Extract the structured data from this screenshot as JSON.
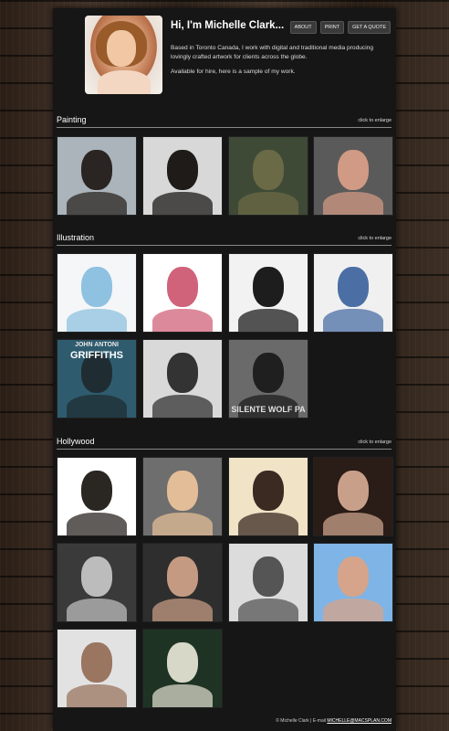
{
  "header": {
    "title": "Hi, I'm Michelle Clark...",
    "bio": [
      "Based in Toronto Canada, I work with digital and traditional media producing lovingly crafted artwork for clients across the globe.",
      "Available for hire, here is a sample of my work."
    ],
    "nav": [
      "ABOUT",
      "PRINT",
      "GET A QUOTE"
    ]
  },
  "sections": [
    {
      "title": "Painting",
      "note": "click to enlarge",
      "thumbs": [
        {
          "bg": "#aab4ba",
          "fg": "#2a2522"
        },
        {
          "bg": "#d8d8d8",
          "fg": "#1e1b19"
        },
        {
          "bg": "#3f4a36",
          "fg": "#6b6a46"
        },
        {
          "bg": "#5a5a5a",
          "fg": "#d09a84"
        }
      ]
    },
    {
      "title": "Illustration",
      "note": "click to enlarge",
      "thumbs": [
        {
          "bg": "#f4f6f8",
          "fg": "#8fc1e0"
        },
        {
          "bg": "#ffffff",
          "fg": "#d0637a"
        },
        {
          "bg": "#f2f2f2",
          "fg": "#1d1d1d"
        },
        {
          "bg": "#f0f0f0",
          "fg": "#4b6fa5"
        },
        {
          "bg": "#2f5b6e",
          "fg": "#1f2d33",
          "text_top": "JOHN ANTONI",
          "text_bottom": "GRIFFITHS"
        },
        {
          "bg": "#d9d9d9",
          "fg": "#333333"
        },
        {
          "bg": "#6a6a6a",
          "fg": "#1f1f1f",
          "text_bottom": "SILENTE WOLF PA"
        }
      ]
    },
    {
      "title": "Hollywood",
      "note": "click to enlarge",
      "thumbs": [
        {
          "bg": "#ffffff",
          "fg": "#2a2622"
        },
        {
          "bg": "#6e6e6e",
          "fg": "#e3bd97"
        },
        {
          "bg": "#f0e3c6",
          "fg": "#3a2a22"
        },
        {
          "bg": "#2a1c16",
          "fg": "#c8a08a"
        },
        {
          "bg": "#3a3a3a",
          "fg": "#bcbcbc"
        },
        {
          "bg": "#2e2e2e",
          "fg": "#c49a82"
        },
        {
          "bg": "#dcdcdc",
          "fg": "#555555"
        },
        {
          "bg": "#7fb4e6",
          "fg": "#d6a48a"
        },
        {
          "bg": "#e2e2e2",
          "fg": "#9a7560"
        },
        {
          "bg": "#1f3324",
          "fg": "#d8d8c8"
        }
      ]
    }
  ],
  "footer": {
    "copyright": "© Michelle Clark | E-mail",
    "email": "MICHELLE@MACSPLAN.COM"
  }
}
